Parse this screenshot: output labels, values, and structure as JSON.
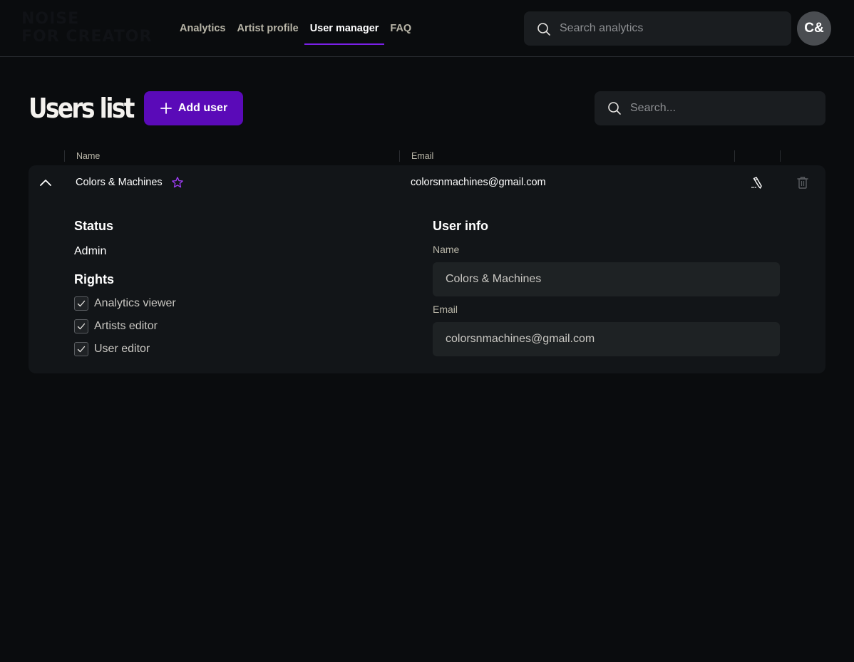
{
  "header": {
    "logo_text": "NOISE\nFOR CREATORS",
    "nav": [
      {
        "label": "Analytics",
        "active": false
      },
      {
        "label": "Artist profile",
        "active": false
      },
      {
        "label": "User manager",
        "active": true
      },
      {
        "label": "FAQ",
        "active": false
      }
    ],
    "search_placeholder": "Search analytics",
    "avatar_initials": "C&"
  },
  "main": {
    "title": "Users list",
    "add_user_label": "Add user",
    "search_placeholder": "Search...",
    "columns": {
      "name": "Name",
      "email": "Email"
    },
    "users": [
      {
        "name": "Colors & Machines",
        "email": "colorsnmachines@gmail.com",
        "expanded": true
      }
    ],
    "details": {
      "status_title": "Status",
      "status_value": "Admin",
      "rights_title": "Rights",
      "rights": [
        {
          "label": "Analytics viewer",
          "checked": true
        },
        {
          "label": "Artists editor",
          "checked": true
        },
        {
          "label": "User editor",
          "checked": true
        }
      ],
      "user_info_title": "User info",
      "name_label": "Name",
      "name_value": "Colors & Machines",
      "email_label": "Email",
      "email_value": "colorsnmachines@gmail.com"
    }
  },
  "colors": {
    "background": "#0a0c0e",
    "accent": "#5a0ab8",
    "nav_underline": "#7a20e8",
    "star": "#9b3cf0"
  }
}
